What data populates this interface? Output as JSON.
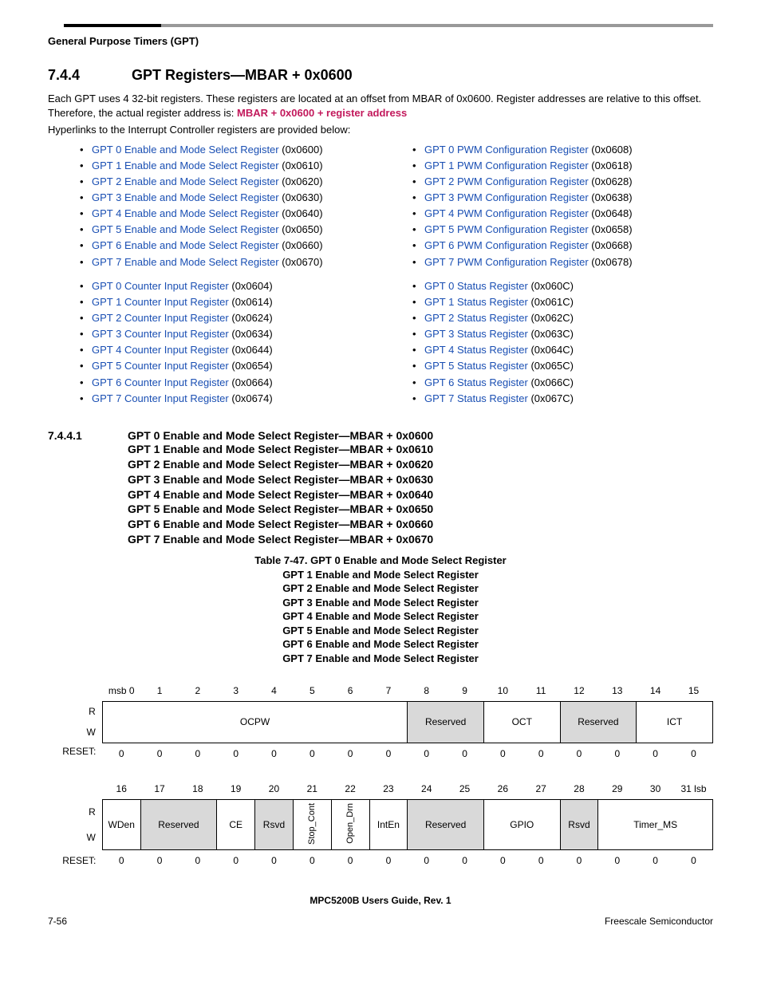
{
  "running_head": "General Purpose Timers (GPT)",
  "sec_num": "7.4.4",
  "sec_title": "GPT Registers—MBAR + 0x0600",
  "para1a": "Each GPT uses 4 32-bit registers. These registers are located at an offset from MBAR of 0x0600. Register addresses are relative to this offset. Therefore, the actual register address is: ",
  "para1b": "MBAR + 0x0600 + register address",
  "para2": "Hyperlinks to the Interrupt Controller registers are provided below:",
  "left_a": [
    {
      "t": "GPT 0 Enable and Mode Select Register",
      "a": " (0x0600)"
    },
    {
      "t": "GPT 1 Enable and Mode Select Register",
      "a": " (0x0610)"
    },
    {
      "t": "GPT 2 Enable and Mode Select Register",
      "a": " (0x0620)"
    },
    {
      "t": "GPT 3 Enable and Mode Select Register",
      "a": " (0x0630)"
    },
    {
      "t": "GPT 4 Enable and Mode Select Register",
      "a": " (0x0640)"
    },
    {
      "t": "GPT 5 Enable and Mode Select Register",
      "a": " (0x0650)"
    },
    {
      "t": "GPT 6 Enable and Mode Select Register",
      "a": " (0x0660)"
    },
    {
      "t": "GPT 7 Enable and Mode Select Register",
      "a": " (0x0670)"
    }
  ],
  "left_b": [
    {
      "t": "GPT 0 Counter Input Register",
      "a": " (0x0604)"
    },
    {
      "t": "GPT 1 Counter Input Register",
      "a": " (0x0614)"
    },
    {
      "t": "GPT 2 Counter Input Register",
      "a": " (0x0624)"
    },
    {
      "t": "GPT 3 Counter Input Register",
      "a": " (0x0634)"
    },
    {
      "t": "GPT 4 Counter Input Register",
      "a": " (0x0644)"
    },
    {
      "t": "GPT 5 Counter Input Register",
      "a": " (0x0654)"
    },
    {
      "t": "GPT 6 Counter Input Register",
      "a": " (0x0664)"
    },
    {
      "t": "GPT 7 Counter Input Register",
      "a": " (0x0674)"
    }
  ],
  "right_a": [
    {
      "t": "GPT 0 PWM Configuration Register",
      "a": " (0x0608)"
    },
    {
      "t": "GPT 1 PWM Configuration Register",
      "a": " (0x0618)"
    },
    {
      "t": "GPT 2 PWM Configuration Register",
      "a": " (0x0628)"
    },
    {
      "t": "GPT 3 PWM Configuration Register",
      "a": " (0x0638)"
    },
    {
      "t": "GPT 4 PWM Configuration Register",
      "a": " (0x0648)"
    },
    {
      "t": "GPT 5 PWM Configuration Register",
      "a": " (0x0658)"
    },
    {
      "t": "GPT 6 PWM Configuration Register",
      "a": " (0x0668)"
    },
    {
      "t": "GPT 7 PWM Configuration Register",
      "a": " (0x0678)"
    }
  ],
  "right_b": [
    {
      "t": "GPT 0 Status Register",
      "a": " (0x060C)"
    },
    {
      "t": "GPT 1 Status Register",
      "a": " (0x061C)"
    },
    {
      "t": "GPT 2 Status Register",
      "a": " (0x062C)"
    },
    {
      "t": "GPT 3 Status Register",
      "a": " (0x063C)"
    },
    {
      "t": "GPT 4 Status Register",
      "a": " (0x064C)"
    },
    {
      "t": "GPT 5 Status Register",
      "a": " (0x065C)"
    },
    {
      "t": "GPT 6 Status Register",
      "a": " (0x066C)"
    },
    {
      "t": "GPT 7 Status Register",
      "a": " (0x067C)"
    }
  ],
  "subsec_num": "7.4.4.1",
  "subsec_lines": [
    "GPT 0 Enable and Mode Select Register—MBAR + 0x0600",
    "GPT 1 Enable and Mode Select Register—MBAR + 0x0610",
    "GPT 2 Enable and Mode Select Register—MBAR + 0x0620",
    "GPT 3 Enable and Mode Select Register—MBAR + 0x0630",
    "GPT 4 Enable and Mode Select Register—MBAR + 0x0640",
    "GPT 5 Enable and Mode Select Register—MBAR + 0x0650",
    "GPT 6 Enable and Mode Select Register—MBAR + 0x0660",
    "GPT 7 Enable and Mode Select Register—MBAR + 0x0670"
  ],
  "tbl_caption_main": "Table 7-47. GPT 0 Enable and Mode Select Register",
  "tbl_caption_sub": [
    "GPT 1 Enable and Mode Select Register",
    "GPT 2 Enable and Mode Select Register",
    "GPT 3 Enable and Mode Select Register",
    "GPT 4 Enable and Mode Select Register",
    "GPT 5 Enable and Mode Select Register",
    "GPT 6 Enable and Mode Select Register",
    "GPT 7 Enable and Mode Select Register"
  ],
  "bits_hi": [
    "msb 0",
    "1",
    "2",
    "3",
    "4",
    "5",
    "6",
    "7",
    "8",
    "9",
    "10",
    "11",
    "12",
    "13",
    "14",
    "15"
  ],
  "bits_lo": [
    "16",
    "17",
    "18",
    "19",
    "20",
    "21",
    "22",
    "23",
    "24",
    "25",
    "26",
    "27",
    "28",
    "29",
    "30",
    "31 lsb"
  ],
  "row_r": "R",
  "row_w": "W",
  "row_reset": "RESET:",
  "row_reset_colon": "RESET:",
  "hi_fields": {
    "ocpw": "OCPW",
    "reserved89": "Reserved",
    "oct": "OCT",
    "reserved1213": "Reserved",
    "ict": "ICT"
  },
  "lo_fields": {
    "wden": "WDen",
    "reserved1718": "Reserved",
    "ce": "CE",
    "rsvd20": "Rsvd",
    "stop_cont": "Stop_Cont",
    "open_drn": "Open_Drn",
    "inten": "IntEn",
    "reserved2425": "Reserved",
    "gpio": "GPIO",
    "rsvd28": "Rsvd",
    "timer_ms": "Timer_MS"
  },
  "reset_hi": [
    "0",
    "0",
    "0",
    "0",
    "0",
    "0",
    "0",
    "0",
    "0",
    "0",
    "0",
    "0",
    "0",
    "0",
    "0",
    "0"
  ],
  "reset_lo": [
    "0",
    "0",
    "0",
    "0",
    "0",
    "0",
    "0",
    "0",
    "0",
    "0",
    "0",
    "0",
    "0",
    "0",
    "0",
    "0"
  ],
  "footer_mid": "MPC5200B Users Guide, Rev. 1",
  "footer_left": "7-56",
  "footer_right": "Freescale Semiconductor"
}
